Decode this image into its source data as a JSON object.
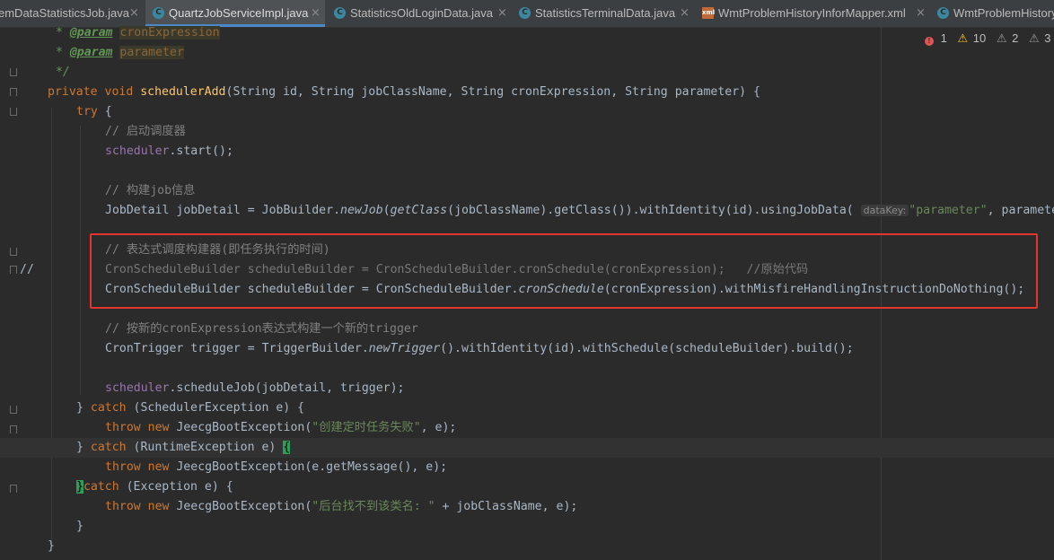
{
  "tabs": [
    {
      "label": "emDataStatisticsJob.java",
      "icon": "java-class-icon",
      "active": false
    },
    {
      "label": "QuartzJobServiceImpl.java",
      "icon": "java-class-icon",
      "active": true
    },
    {
      "label": "StatisticsOldLoginData.java",
      "icon": "java-class-icon",
      "active": false
    },
    {
      "label": "StatisticsTerminalData.java",
      "icon": "java-class-icon",
      "active": false
    },
    {
      "label": "WmtProblemHistoryInforMapper.xml",
      "icon": "xml-file-icon",
      "active": false
    },
    {
      "label": "WmtProblemHistoryInfor",
      "icon": "java-class-icon",
      "active": false
    }
  ],
  "tab_close_glyph": "×",
  "inspections": {
    "errors": "1",
    "warnings": "10",
    "weak_warnings": "2",
    "typos": "3"
  },
  "gutter": {
    "commented_marker": "//"
  },
  "code": {
    "l1_star": " * ",
    "l1_tag": "@param",
    "l1_sp": " ",
    "l1_name": "cronExpression",
    "l2_star": " * ",
    "l2_tag": "@param",
    "l2_sp": " ",
    "l2_name": "parameter",
    "l3": " */",
    "l4_kw": "private void ",
    "l4_fn": "schedulerAdd",
    "l4_rest": "(String id, String jobClassName, String cronExpression, String parameter) {",
    "l5_kw": "try",
    "l5_rest": " {",
    "l6": "// 启动调度器",
    "l7_fld": "scheduler",
    "l7_rest": ".start();",
    "l8": "// 构建job信息",
    "l9_a": "JobDetail jobDetail = JobBuilder.",
    "l9_it": "newJob",
    "l9_b": "(",
    "l9_it2": "getClass",
    "l9_c": "(jobClassName).getClass()).withIdentity(id).usingJobData( ",
    "l9_hint": "dataKey:",
    "l9_str": "\"parameter\"",
    "l9_d": ", parameter",
    "l10": "// 表达式调度构建器(即任务执行的时间)",
    "l11": "CronScheduleBuilder scheduleBuilder = CronScheduleBuilder.cronSchedule(cronExpression);   //原始代码",
    "l12_a": "CronScheduleBuilder scheduleBuilder = CronScheduleBuilder.",
    "l12_it": "cronSchedule",
    "l12_b": "(cronExpression).withMisfireHandlingInstructionDoNothing();",
    "l13": "// 按新的cronExpression表达式构建一个新的trigger",
    "l14_a": "CronTrigger trigger = TriggerBuilder.",
    "l14_it": "newTrigger",
    "l14_b": "().withIdentity(id).withSchedule(scheduleBuilder).build();",
    "l15_fld": "scheduler",
    "l15_rest": ".scheduleJob(jobDetail, trigger);",
    "l16_a": "} ",
    "l16_kw": "catch",
    "l16_b": " (SchedulerException e) {",
    "l17_kw": "throw new ",
    "l17_a": "JeecgBootException(",
    "l17_str": "\"创建定时任务失败\"",
    "l17_b": ", e);",
    "l18_a": "} ",
    "l18_kw": "catch",
    "l18_b": " (RuntimeException e) ",
    "l18_br": "{",
    "l19_kw": "throw new ",
    "l19_a": "JeecgBootException(e.getMessage(), e);",
    "l20_br": "}",
    "l20_kw": "catch",
    "l20_b": " (Exception e) {",
    "l21_kw": "throw new ",
    "l21_a": "JeecgBootException(",
    "l21_str": "\"后台找不到该类名: \"",
    "l21_b": " + jobClassName, e);",
    "l22": "}",
    "l23": "}"
  }
}
